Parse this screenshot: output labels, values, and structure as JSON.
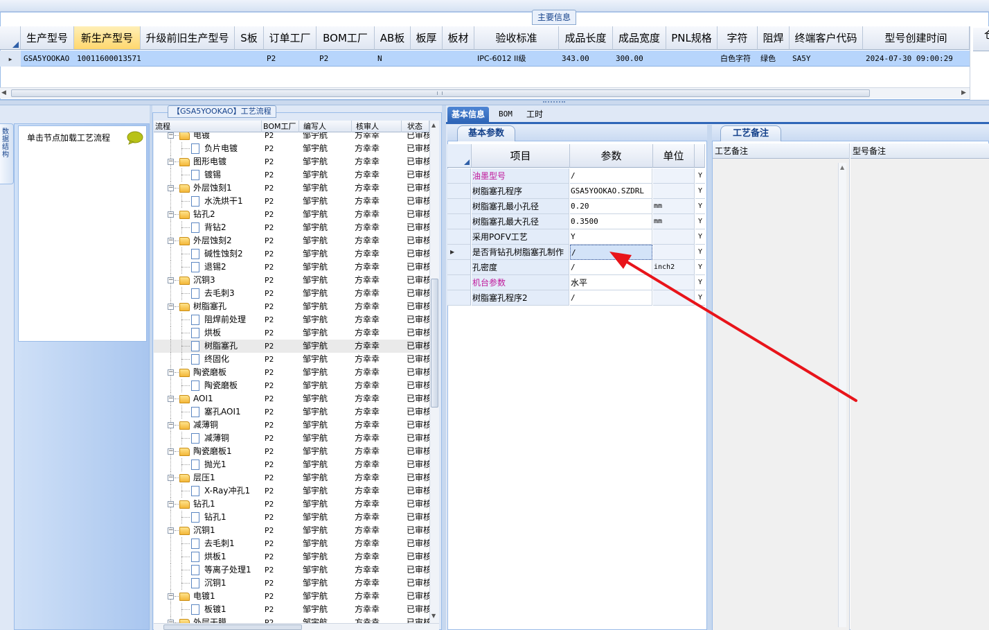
{
  "main_info": {
    "title": "主要信息",
    "columns": [
      {
        "label": "生产型号",
        "highlight": false
      },
      {
        "label": "新生产型号",
        "highlight": true
      },
      {
        "label": "升级前旧生产型号",
        "highlight": false
      },
      {
        "label": "S板",
        "highlight": false
      },
      {
        "label": "订单工厂",
        "highlight": false
      },
      {
        "label": "BOM工厂",
        "highlight": false
      },
      {
        "label": "AB板",
        "highlight": false
      },
      {
        "label": "板厚",
        "highlight": false
      },
      {
        "label": "板材",
        "highlight": false
      },
      {
        "label": "验收标准",
        "highlight": false
      },
      {
        "label": "成品长度",
        "highlight": false
      },
      {
        "label": "成品宽度",
        "highlight": false
      },
      {
        "label": "PNL规格",
        "highlight": false
      },
      {
        "label": "字符",
        "highlight": false
      },
      {
        "label": "阻焊",
        "highlight": false
      },
      {
        "label": "终端客户代码",
        "highlight": false
      },
      {
        "label": "型号创建时间",
        "highlight": false
      }
    ],
    "row": {
      "production_model": "GSA5YOOKAO",
      "new_production_model": "10011600013571",
      "old_model": "",
      "s_board": "",
      "order_factory": "P2",
      "bom_factory": "P2",
      "ab_board": "N",
      "thickness": "",
      "material": "",
      "standard": "IPC-6012 II级",
      "length": "343.00",
      "width": "300.00",
      "pnl_spec": "",
      "character": "白色字符",
      "solder_mask": "绿色",
      "customer_code": "SA5Y",
      "created_time": "2024-07-30 09:00:29"
    },
    "right_edge_label": "仓"
  },
  "side_tab": {
    "label": "数据结构"
  },
  "left_panel": {
    "hint": "单击节点加载工艺流程",
    "icon": "chat-bubble-icon"
  },
  "process_tree": {
    "title": "【GSA5YOOKAO】工艺流程",
    "columns": [
      "流程",
      "BOM工厂",
      "编写人",
      "核审人",
      "状态"
    ],
    "rows": [
      {
        "name": "电镀",
        "level": 0,
        "bom": "P2",
        "writer": "邹宇航",
        "reviewer": "方幸幸",
        "status": "已审核"
      },
      {
        "name": "负片电镀",
        "level": 1,
        "bom": "P2",
        "writer": "邹宇航",
        "reviewer": "方幸幸",
        "status": "已审核"
      },
      {
        "name": "图形电镀",
        "level": 0,
        "bom": "P2",
        "writer": "邹宇航",
        "reviewer": "方幸幸",
        "status": "已审核"
      },
      {
        "name": "镀锡",
        "level": 1,
        "bom": "P2",
        "writer": "邹宇航",
        "reviewer": "方幸幸",
        "status": "已审核"
      },
      {
        "name": "外层蚀刻1",
        "level": 0,
        "bom": "P2",
        "writer": "邹宇航",
        "reviewer": "方幸幸",
        "status": "已审核"
      },
      {
        "name": "水洗烘干1",
        "level": 1,
        "bom": "P2",
        "writer": "邹宇航",
        "reviewer": "方幸幸",
        "status": "已审核"
      },
      {
        "name": "钻孔2",
        "level": 0,
        "bom": "P2",
        "writer": "邹宇航",
        "reviewer": "方幸幸",
        "status": "已审核"
      },
      {
        "name": "背钻2",
        "level": 1,
        "bom": "P2",
        "writer": "邹宇航",
        "reviewer": "方幸幸",
        "status": "已审核"
      },
      {
        "name": "外层蚀刻2",
        "level": 0,
        "bom": "P2",
        "writer": "邹宇航",
        "reviewer": "方幸幸",
        "status": "已审核"
      },
      {
        "name": "碱性蚀刻2",
        "level": 1,
        "bom": "P2",
        "writer": "邹宇航",
        "reviewer": "方幸幸",
        "status": "已审核"
      },
      {
        "name": "退锡2",
        "level": 1,
        "bom": "P2",
        "writer": "邹宇航",
        "reviewer": "方幸幸",
        "status": "已审核"
      },
      {
        "name": "沉铜3",
        "level": 0,
        "bom": "P2",
        "writer": "邹宇航",
        "reviewer": "方幸幸",
        "status": "已审核"
      },
      {
        "name": "去毛刺3",
        "level": 1,
        "bom": "P2",
        "writer": "邹宇航",
        "reviewer": "方幸幸",
        "status": "已审核"
      },
      {
        "name": "树脂塞孔",
        "level": 0,
        "bom": "P2",
        "writer": "邹宇航",
        "reviewer": "方幸幸",
        "status": "已审核"
      },
      {
        "name": "阻焊前处理",
        "level": 1,
        "bom": "P2",
        "writer": "邹宇航",
        "reviewer": "方幸幸",
        "status": "已审核"
      },
      {
        "name": "烘板",
        "level": 1,
        "bom": "P2",
        "writer": "邹宇航",
        "reviewer": "方幸幸",
        "status": "已审核"
      },
      {
        "name": "树脂塞孔",
        "level": 1,
        "bom": "P2",
        "writer": "邹宇航",
        "reviewer": "方幸幸",
        "status": "已审核",
        "selected": true
      },
      {
        "name": "终固化",
        "level": 1,
        "bom": "P2",
        "writer": "邹宇航",
        "reviewer": "方幸幸",
        "status": "已审核"
      },
      {
        "name": "陶瓷磨板",
        "level": 0,
        "bom": "P2",
        "writer": "邹宇航",
        "reviewer": "方幸幸",
        "status": "已审核"
      },
      {
        "name": "陶瓷磨板",
        "level": 1,
        "bom": "P2",
        "writer": "邹宇航",
        "reviewer": "方幸幸",
        "status": "已审核"
      },
      {
        "name": "AOI1",
        "level": 0,
        "bom": "P2",
        "writer": "邹宇航",
        "reviewer": "方幸幸",
        "status": "已审核"
      },
      {
        "name": "塞孔AOI1",
        "level": 1,
        "bom": "P2",
        "writer": "邹宇航",
        "reviewer": "方幸幸",
        "status": "已审核"
      },
      {
        "name": "减薄铜",
        "level": 0,
        "bom": "P2",
        "writer": "邹宇航",
        "reviewer": "方幸幸",
        "status": "已审核"
      },
      {
        "name": "减薄铜",
        "level": 1,
        "bom": "P2",
        "writer": "邹宇航",
        "reviewer": "方幸幸",
        "status": "已审核"
      },
      {
        "name": "陶瓷磨板1",
        "level": 0,
        "bom": "P2",
        "writer": "邹宇航",
        "reviewer": "方幸幸",
        "status": "已审核"
      },
      {
        "name": "抛光1",
        "level": 1,
        "bom": "P2",
        "writer": "邹宇航",
        "reviewer": "方幸幸",
        "status": "已审核"
      },
      {
        "name": "层压1",
        "level": 0,
        "bom": "P2",
        "writer": "邹宇航",
        "reviewer": "方幸幸",
        "status": "已审核"
      },
      {
        "name": "X-Ray冲孔1",
        "level": 1,
        "bom": "P2",
        "writer": "邹宇航",
        "reviewer": "方幸幸",
        "status": "已审核"
      },
      {
        "name": "钻孔1",
        "level": 0,
        "bom": "P2",
        "writer": "邹宇航",
        "reviewer": "方幸幸",
        "status": "已审核"
      },
      {
        "name": "钻孔1",
        "level": 1,
        "bom": "P2",
        "writer": "邹宇航",
        "reviewer": "方幸幸",
        "status": "已审核"
      },
      {
        "name": "沉铜1",
        "level": 0,
        "bom": "P2",
        "writer": "邹宇航",
        "reviewer": "方幸幸",
        "status": "已审核"
      },
      {
        "name": "去毛刺1",
        "level": 1,
        "bom": "P2",
        "writer": "邹宇航",
        "reviewer": "方幸幸",
        "status": "已审核"
      },
      {
        "name": "烘板1",
        "level": 1,
        "bom": "P2",
        "writer": "邹宇航",
        "reviewer": "方幸幸",
        "status": "已审核"
      },
      {
        "name": "等离子处理1",
        "level": 1,
        "bom": "P2",
        "writer": "邹宇航",
        "reviewer": "方幸幸",
        "status": "已审核"
      },
      {
        "name": "沉铜1",
        "level": 1,
        "bom": "P2",
        "writer": "邹宇航",
        "reviewer": "方幸幸",
        "status": "已审核"
      },
      {
        "name": "电镀1",
        "level": 0,
        "bom": "P2",
        "writer": "邹宇航",
        "reviewer": "方幸幸",
        "status": "已审核"
      },
      {
        "name": "板镀1",
        "level": 1,
        "bom": "P2",
        "writer": "邹宇航",
        "reviewer": "方幸幸",
        "status": "已审核"
      },
      {
        "name": "外层干膜",
        "level": 0,
        "bom": "P2",
        "writer": "邹宇航",
        "reviewer": "方幸幸",
        "status": "已审核"
      }
    ]
  },
  "detail_tabs": [
    {
      "label": "基本信息",
      "active": true
    },
    {
      "label": "BOM",
      "active": false
    },
    {
      "label": "工时",
      "active": false
    }
  ],
  "basic_params": {
    "tab_label": "基本参数",
    "columns": [
      "项目",
      "参数",
      "单位"
    ],
    "rows": [
      {
        "name": "油墨型号",
        "value": "/",
        "unit": "",
        "flag": "Y",
        "magenta": true
      },
      {
        "name": "树脂塞孔程序",
        "value": "GSA5YOOKAO.SZDRL",
        "unit": "",
        "flag": "Y"
      },
      {
        "name": "树脂塞孔最小孔径",
        "value": "0.20",
        "unit": "mm",
        "flag": "Y"
      },
      {
        "name": "树脂塞孔最大孔径",
        "value": "0.3500",
        "unit": "mm",
        "flag": "Y"
      },
      {
        "name": "采用POFV工艺",
        "value": "Y",
        "unit": "",
        "flag": "Y"
      },
      {
        "name": "是否背钻孔树脂塞孔制作",
        "value": "/",
        "unit": "",
        "flag": "Y",
        "current": true,
        "editing": true
      },
      {
        "name": "孔密度",
        "value": "/",
        "unit": "inch2",
        "flag": "Y"
      },
      {
        "name": "机台参数",
        "value": "水平",
        "unit": "",
        "flag": "Y",
        "magenta": true
      },
      {
        "name": "树脂塞孔程序2",
        "value": "/",
        "unit": "",
        "flag": "Y"
      }
    ]
  },
  "process_notes": {
    "tab_label": "工艺备注",
    "columns": [
      "工艺备注",
      "型号备注"
    ]
  },
  "colors": {
    "accent": "#2f66b8",
    "selection_row": "#b7d5fc",
    "header_highlight": "#ffd76e",
    "magenta_label": "#c0189a",
    "annotation_arrow": "#e8141a"
  }
}
